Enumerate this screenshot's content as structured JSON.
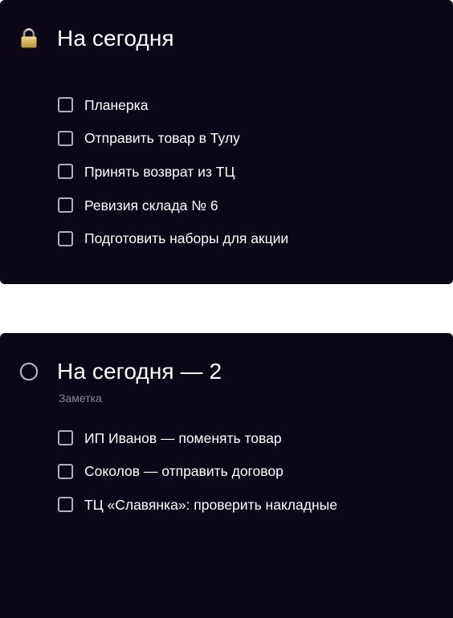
{
  "lists": [
    {
      "icon": "lock-icon",
      "title": "На сегодня",
      "items": [
        {
          "label": "Планерка",
          "checked": false
        },
        {
          "label": "Отправить товар в Тулу",
          "checked": false
        },
        {
          "label": "Принять возврат из ТЦ",
          "checked": false
        },
        {
          "label": "Ревизия склада № 6",
          "checked": false
        },
        {
          "label": "Подготовить наборы для акции",
          "checked": false
        }
      ]
    },
    {
      "icon": "circle-icon",
      "title": "На сегодня — 2",
      "subtitle": "Заметка",
      "items": [
        {
          "label": "ИП Иванов — поменять товар",
          "checked": false
        },
        {
          "label": "Соколов — отправить договор",
          "checked": false
        },
        {
          "label": "ТЦ «Славянка»: проверить накладные",
          "checked": false
        }
      ]
    }
  ],
  "colors": {
    "card_background": "#0b0716",
    "text": "#ffffff",
    "muted_text": "#8a8896",
    "checkbox_border": "#aeb0bb",
    "lock_gold": "#d4b45c"
  }
}
